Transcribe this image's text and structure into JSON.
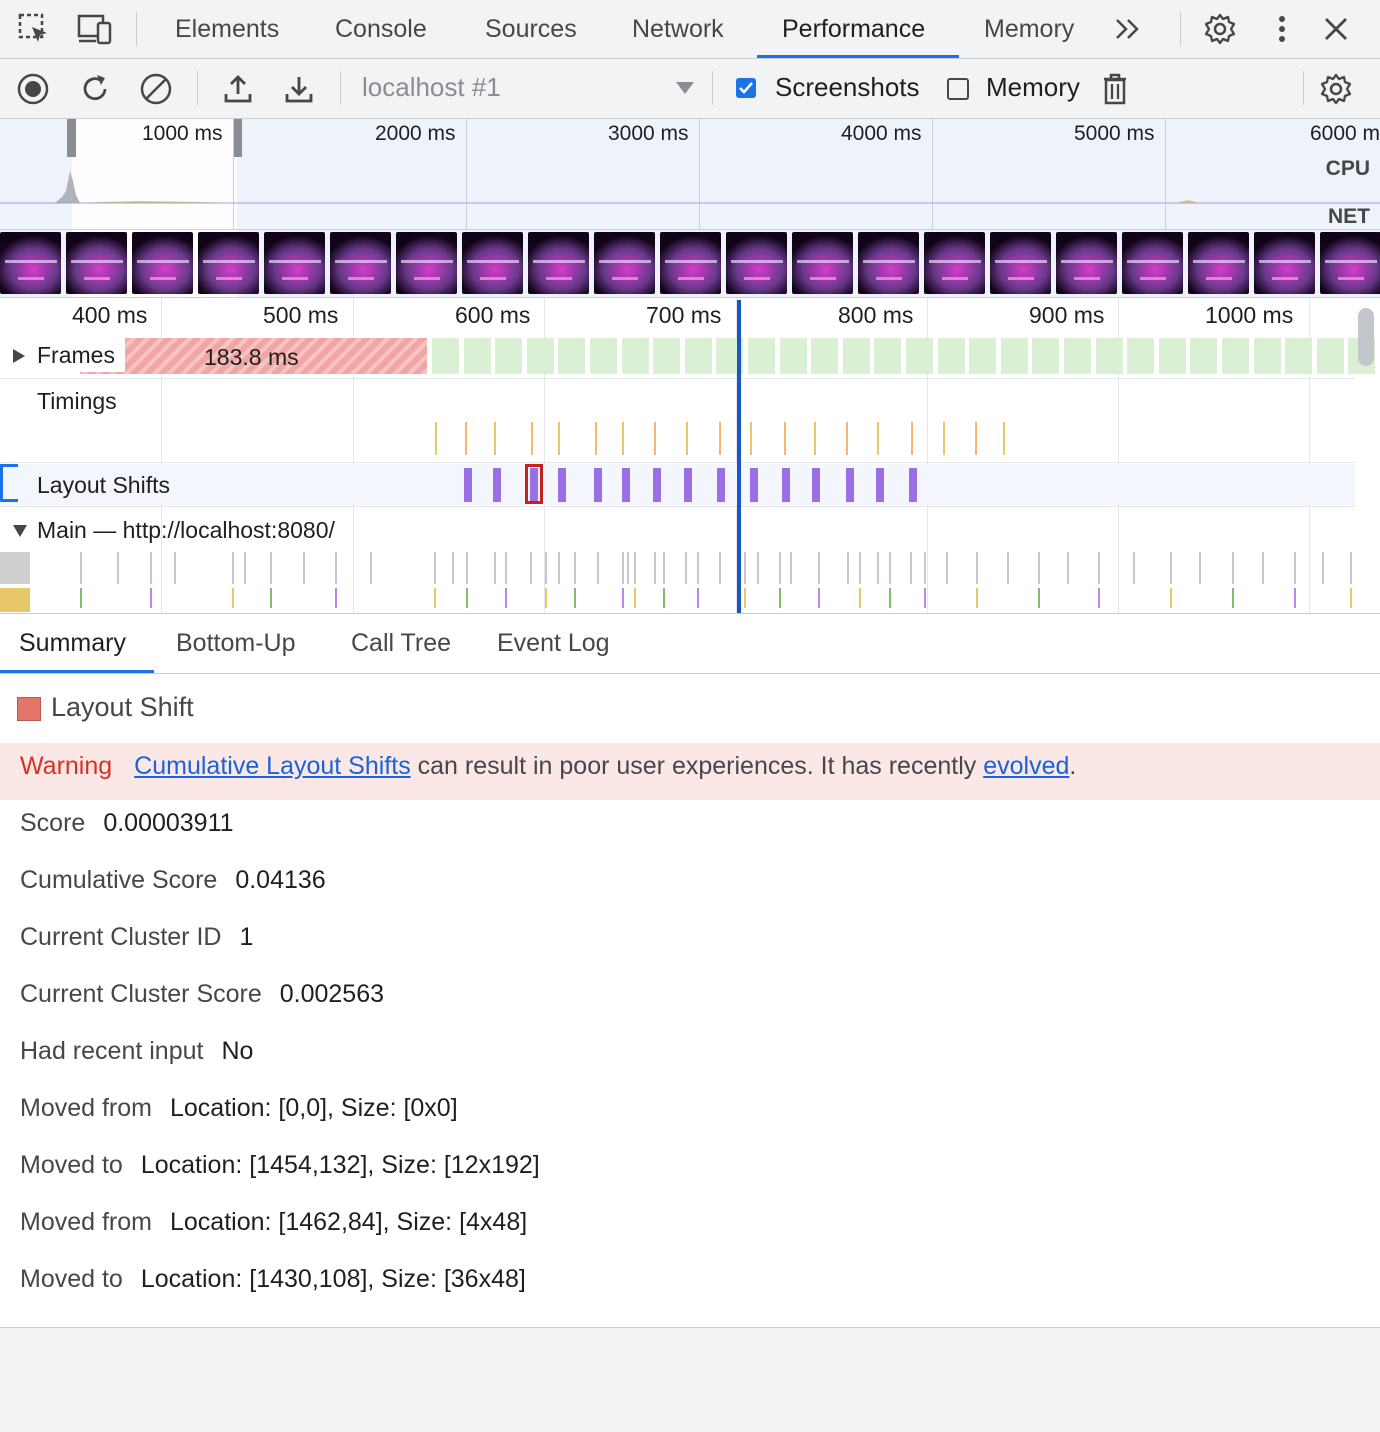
{
  "tabs": [
    "Elements",
    "Console",
    "Sources",
    "Network",
    "Performance",
    "Memory"
  ],
  "active_tab": "Performance",
  "toolbar": {
    "target": "localhost #1",
    "screenshots_label": "Screenshots",
    "screenshots_checked": true,
    "memory_label": "Memory",
    "memory_checked": false
  },
  "overview": {
    "labels": [
      "1000 ms",
      "2000 ms",
      "3000 ms",
      "4000 ms",
      "5000 ms",
      "6000 ms"
    ],
    "cpu_label": "CPU",
    "net_label": "NET"
  },
  "timeline": {
    "ruler": [
      "400 ms",
      "500 ms",
      "600 ms",
      "700 ms",
      "800 ms",
      "900 ms",
      "1000 ms"
    ],
    "frames_label": "Frames",
    "frame_duration": "183.8 ms",
    "timings_label": "Timings",
    "layout_shifts_label": "Layout Shifts",
    "main_label": "Main — http://localhost:8080/"
  },
  "bottom_tabs": [
    "Summary",
    "Bottom-Up",
    "Call Tree",
    "Event Log"
  ],
  "summary": {
    "title": "Layout Shift",
    "swatch_color": "#e4776a",
    "warning": {
      "label": "Warning",
      "link1": "Cumulative Layout Shifts",
      "text": " can result in poor user experiences. It has recently ",
      "link2": "evolved",
      "end": "."
    },
    "rows": [
      {
        "label": "Score",
        "value": "0.00003911"
      },
      {
        "label": "Cumulative Score",
        "value": "0.04136"
      },
      {
        "label": "Current Cluster ID",
        "value": "1"
      },
      {
        "label": "Current Cluster Score",
        "value": "0.002563"
      },
      {
        "label": "Had recent input",
        "value": "No"
      },
      {
        "label": "Moved from",
        "value": "Location: [0,0], Size: [0x0]"
      },
      {
        "label": "Moved to",
        "value": "Location: [1454,132], Size: [12x192]"
      },
      {
        "label": "Moved from",
        "value": "Location: [1462,84], Size: [4x48]"
      },
      {
        "label": "Moved to",
        "value": "Location: [1430,108], Size: [36x48]"
      }
    ]
  },
  "colors": {
    "accent": "#1a73e8",
    "layout_shift": "#9a6fe3",
    "frame_ok": "#d9f0d4",
    "frame_long": "#f2a5a5",
    "warning_bg": "#fbe8e6",
    "warning_text": "#d93025"
  }
}
